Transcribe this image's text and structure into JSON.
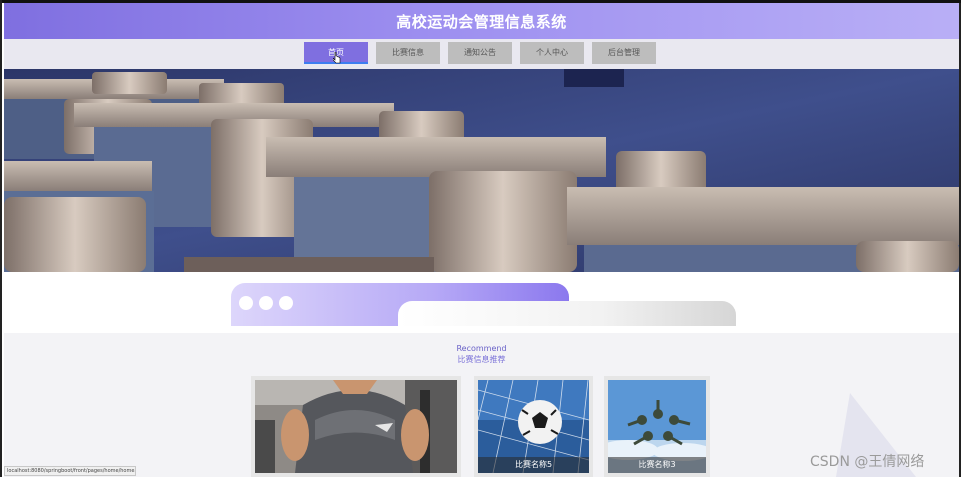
{
  "header": {
    "title": "高校运动会管理信息系统"
  },
  "nav": {
    "items": [
      {
        "label": "首页",
        "active": true
      },
      {
        "label": "比赛信息",
        "active": false
      },
      {
        "label": "通知公告",
        "active": false
      },
      {
        "label": "个人中心",
        "active": false
      },
      {
        "label": "后台管理",
        "active": false
      }
    ]
  },
  "section": {
    "title_en": "Recommend",
    "title_cn": "比赛信息推荐"
  },
  "cards": [
    {
      "caption": ""
    },
    {
      "caption": "比赛名称5"
    },
    {
      "caption": "比赛名称3"
    }
  ],
  "status_bar": {
    "url": "localhost:8080/springboot/front/pages/home/home.jsp"
  },
  "watermark": "CSDN @王倩网络",
  "colors": {
    "accent": "#7f6fe0",
    "header_gradient_end": "#b9aff6",
    "nav_button": "#bdbdbd"
  }
}
